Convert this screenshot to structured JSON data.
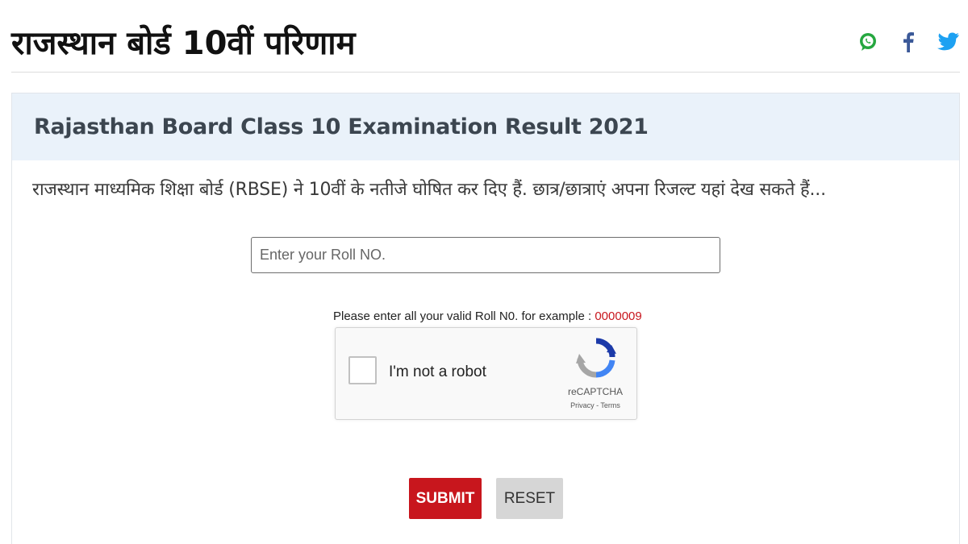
{
  "header": {
    "title": "राजस्थान बोर्ड 10वीं परिणाम",
    "share": [
      {
        "icon": "whatsapp-icon",
        "color": "#25a73f"
      },
      {
        "icon": "facebook-icon",
        "color": "#3b5998"
      },
      {
        "icon": "twitter-icon",
        "color": "#1da1f2"
      }
    ]
  },
  "card": {
    "title": "Rajasthan Board Class 10 Examination Result 2021",
    "intro": "राजस्थान माध्यमिक शिक्षा बोर्ड (RBSE) ने 10वीं के नतीजे घोषित कर दिए हैं. छात्र/छात्राएं अपना रिजल्ट यहां देख सकते हैं...",
    "header_bg": "#eaf2fa"
  },
  "form": {
    "roll_input": {
      "placeholder": "Enter your Roll NO.",
      "value": ""
    },
    "hint": "Please enter all your valid Roll N0. for example : ",
    "hint_example": "0000009",
    "captcha": {
      "label": "I'm not a robot",
      "brand": "reCAPTCHA",
      "links": "Privacy - Terms",
      "checked": false
    },
    "submit_label": "SUBMIT",
    "reset_label": "RESET",
    "accent": "#c8161d"
  }
}
